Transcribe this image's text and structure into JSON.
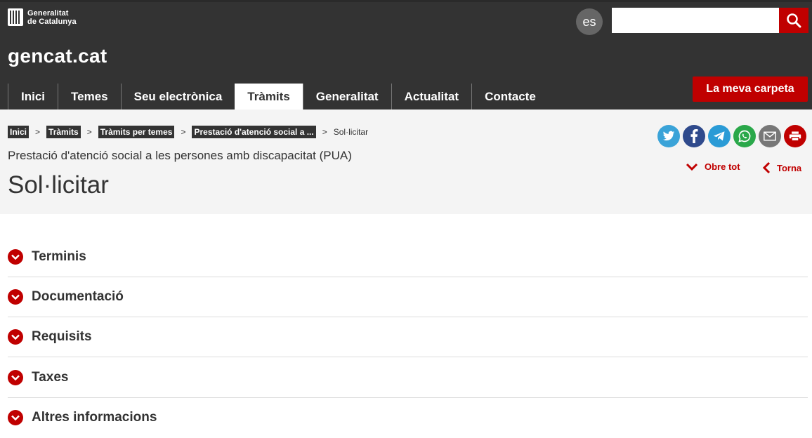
{
  "header": {
    "logo_line1": "Generalitat",
    "logo_line2": "de Catalunya",
    "site_title": "gencat.cat",
    "lang_button": "es",
    "search_value": "",
    "search_placeholder": "",
    "search_icon": "search-icon",
    "nav": [
      {
        "label": "Inici",
        "active": false
      },
      {
        "label": "Temes",
        "active": false
      },
      {
        "label": "Seu electrònica",
        "active": false
      },
      {
        "label": "Tràmits",
        "active": true
      },
      {
        "label": "Generalitat",
        "active": false
      },
      {
        "label": "Actualitat",
        "active": false
      },
      {
        "label": "Contacte",
        "active": false
      }
    ],
    "carpeta_button": "La meva carpeta"
  },
  "breadcrumb": {
    "items": [
      "Inici",
      "Tràmits",
      "Tràmits per temes",
      "Prestació d'atenció social a ..."
    ],
    "separator": ">",
    "current": "Sol·licitar"
  },
  "page": {
    "subtitle": "Prestació d'atenció social a les persones amb discapacitat (PUA)",
    "title": "Sol·licitar"
  },
  "share_icons": [
    {
      "name": "twitter-icon",
      "color": "#3aa3d8"
    },
    {
      "name": "facebook-icon",
      "color": "#2f4a8c"
    },
    {
      "name": "telegram-icon",
      "color": "#2a9bd6"
    },
    {
      "name": "whatsapp-icon",
      "color": "#2aa84a"
    },
    {
      "name": "email-icon",
      "color": "#777777"
    },
    {
      "name": "print-icon",
      "color": "#c00000"
    }
  ],
  "actions": {
    "expand_all": "Obre tot",
    "back": "Torna"
  },
  "sections": [
    "Terminis",
    "Documentació",
    "Requisits",
    "Taxes",
    "Altres informacions"
  ],
  "colors": {
    "header_bg": "#333333",
    "accent_red": "#c00000",
    "band_bg": "#f4f4f4"
  }
}
